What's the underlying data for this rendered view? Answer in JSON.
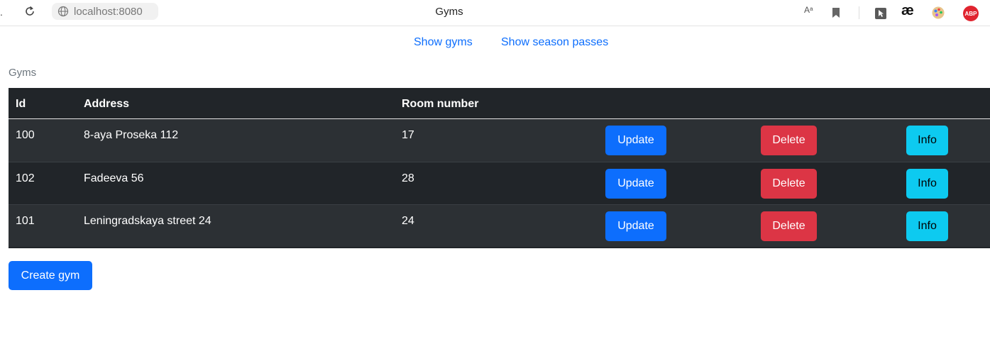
{
  "browser": {
    "back_glyph": ".",
    "url": "localhost:8080",
    "tab_title": "Gyms",
    "read_aloud": "Aᵃ",
    "ext_ae": "æ",
    "abp_label": "ABP"
  },
  "nav": {
    "show_gyms": "Show gyms",
    "show_passes": "Show season passes"
  },
  "caption": "Gyms",
  "table": {
    "headers": {
      "id": "Id",
      "address": "Address",
      "room": "Room number"
    },
    "rows": [
      {
        "id": "100",
        "address": "8-aya Proseka 112",
        "room": "17",
        "update": "Update",
        "delete": "Delete",
        "info": "Info"
      },
      {
        "id": "102",
        "address": "Fadeeva 56",
        "room": "28",
        "update": "Update",
        "delete": "Delete",
        "info": "Info"
      },
      {
        "id": "101",
        "address": "Leningradskaya street 24",
        "room": "24",
        "update": "Update",
        "delete": "Delete",
        "info": "Info"
      }
    ]
  },
  "create_button": "Create gym",
  "colors": {
    "primary": "#0d6efd",
    "danger": "#dc3545",
    "info": "#0dcaf0",
    "table_dark": "#212529"
  }
}
